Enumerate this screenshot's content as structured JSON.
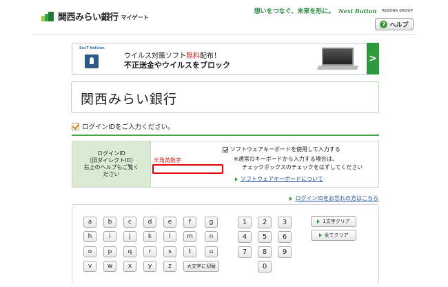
{
  "header": {
    "bank_name": "関西みらい銀行",
    "service_name": "マイゲート",
    "slogan": "想いをつなぐ、未来を形に。",
    "group_logo": "Next Button",
    "group_name": "RESONA GROUP",
    "help_label": "ヘルプ",
    "help_icon": "?"
  },
  "banner": {
    "logo": "SecT Netizen",
    "line1_pre": "ウイルス対策ソフト",
    "line1_highlight": "無料",
    "line1_post": "配布！",
    "line2": "不正送金やウイルスをブロック",
    "arrow": ">"
  },
  "title": "関西みらい銀行",
  "instruction": "ログインIDをご入力ください。",
  "form": {
    "label_lines": [
      "ログインID",
      "（旧ダイレクトID）",
      "右上のヘルプもご覧く",
      "ださい"
    ],
    "hankaku_hint": "半角英数字",
    "login_id_value": "",
    "software_kb_label": "ソフトウェアキーボードを使用して入力する",
    "note_line1": "※通常のキーボードから入力する場合は、",
    "note_line2": "チェックボックスのチェックをはずしてください",
    "software_kb_link": "ソフトウェアキーボードについて"
  },
  "forgot_link": "ログインIDをお忘れの方はこちら",
  "keyboard": {
    "letter_rows": [
      [
        "a",
        "b",
        "c",
        "d",
        "e",
        "f"
      ],
      [
        "h",
        "i",
        "j",
        "k",
        "l",
        "m"
      ],
      [
        "o",
        "p",
        "q",
        "r",
        "s",
        "t"
      ],
      [
        "v",
        "w",
        "x",
        "y",
        "z"
      ]
    ],
    "extra_keys": [
      "g",
      "n",
      "u"
    ],
    "case_toggle": "大文字に切替",
    "digit_rows": [
      [
        "1",
        "2",
        "3"
      ],
      [
        "4",
        "5",
        "6"
      ],
      [
        "7",
        "8",
        "9"
      ],
      [
        "0"
      ]
    ],
    "delete_one": "1文字クリア",
    "delete_all": "全てクリア"
  },
  "colors": {
    "brand_green": "#2e9a3e",
    "error_red": "#e00000",
    "link_blue": "#1a4fa0",
    "label_bg": "#d9ecd3"
  }
}
